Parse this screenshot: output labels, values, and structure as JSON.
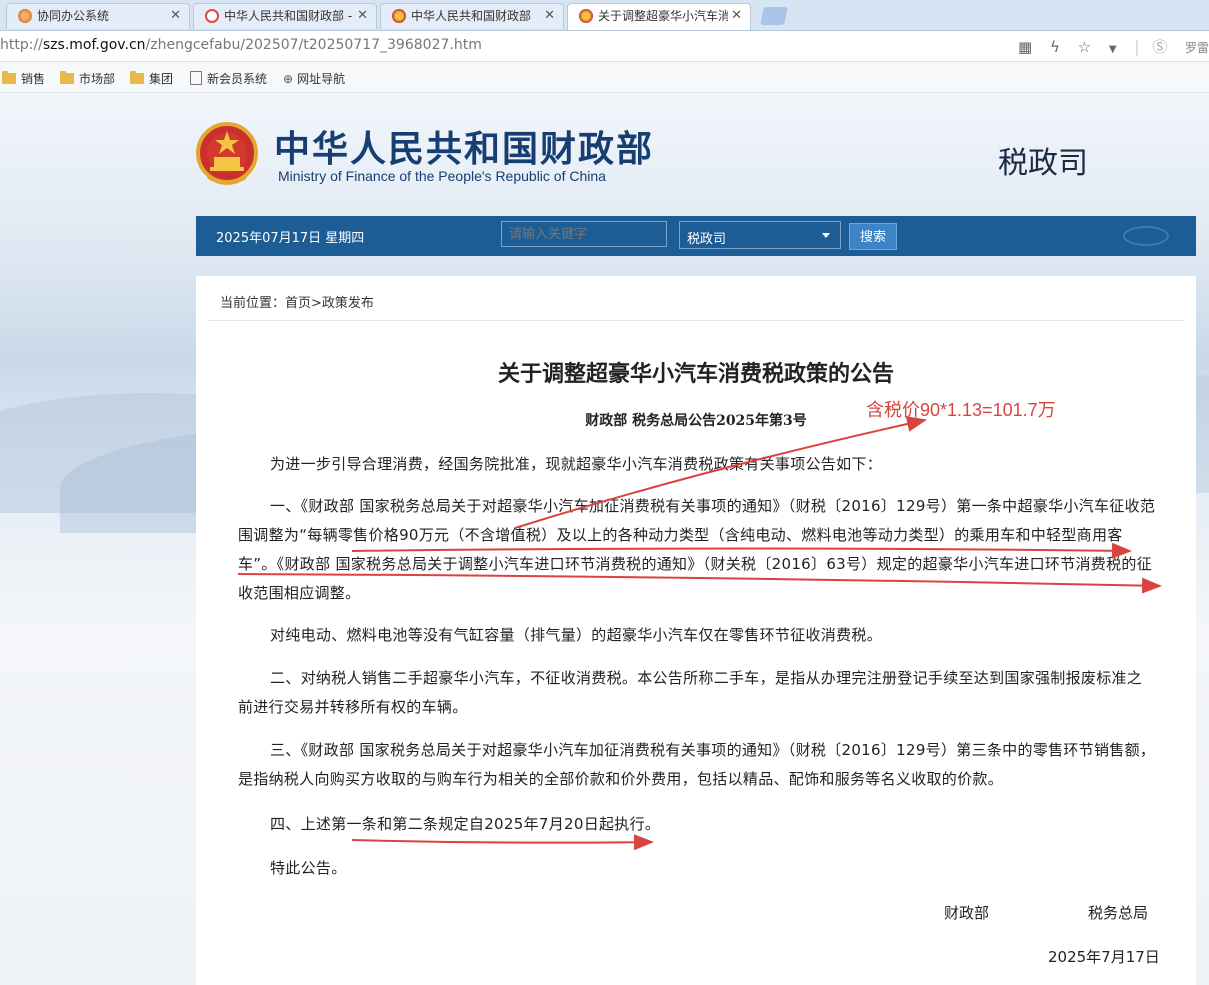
{
  "browser": {
    "tabs": [
      {
        "label": "协同办公系统",
        "active": false
      },
      {
        "label": "中华人民共和国财政部 -",
        "active": false
      },
      {
        "label": "中华人民共和国财政部",
        "active": false
      },
      {
        "label": "关于调整超豪华小汽车消",
        "active": true
      }
    ],
    "url_prefix": "http://",
    "url_host": "szs.mof.gov.cn",
    "url_path": "/zhengcefabu/202507/t20250717_3968027.htm",
    "right_label": "罗雷",
    "bookmarks": [
      "销售",
      "市场部",
      "集团",
      "新会员系统",
      "网址导航"
    ]
  },
  "site": {
    "name_cn": "中华人民共和国财政部",
    "name_en": "Ministry of Finance of the People's Republic of China",
    "department": "税政司"
  },
  "navbar": {
    "date": "2025年07月17日  星期四",
    "search_placeholder": "请输入关键字",
    "scope": "税政司",
    "search_button": "搜索"
  },
  "article": {
    "breadcrumb": "当前位置：首页>政策发布",
    "title": "关于调整超豪华小汽车消费税政策的公告",
    "subtitle": "财政部  税务总局公告2025年第3号",
    "paragraphs": [
      "为进一步引导合理消费，经国务院批准，现就超豪华小汽车消费税政策有关事项公告如下：",
      "一、《财政部 国家税务总局关于对超豪华小汽车加征消费税有关事项的通知》（财税〔2016〕129号）第一条中超豪华小汽车征收范围调整为“每辆零售价格90万元（不含增值税）及以上的各种动力类型（含纯电动、燃料电池等动力类型）的乘用车和中轻型商用客车”。《财政部 国家税务总局关于调整小汽车进口环节消费税的通知》（财关税〔2016〕63号）规定的超豪华小汽车进口环节消费税的征收范围相应调整。",
      "对纯电动、燃料电池等没有气缸容量（排气量）的超豪华小汽车仅在零售环节征收消费税。",
      "二、对纳税人销售二手超豪华小汽车，不征收消费税。本公告所称二手车，是指从办理完注册登记手续至达到国家强制报废标准之前进行交易并转移所有权的车辆。",
      "三、《财政部 国家税务总局关于对超豪华小汽车加征消费税有关事项的通知》（财税〔2016〕129号）第三条中的零售环节销售额，是指纳税人向购买方收取的与购车行为相关的全部价款和价外费用，包括以精品、配饰和服务等名义收取的价款。",
      "四、上述第一条和第二条规定自2025年7月20日起执行。",
      "特此公告。"
    ],
    "signers": [
      "财政部",
      "税务总局"
    ],
    "sign_date": "2025年7月17日"
  },
  "annotation": {
    "text": "含税价90*1.13=101.7万",
    "color": "#d8453f"
  },
  "colors": {
    "navbar": "#1d5d95",
    "site_title": "#173e72",
    "annotation": "#d8453f"
  }
}
